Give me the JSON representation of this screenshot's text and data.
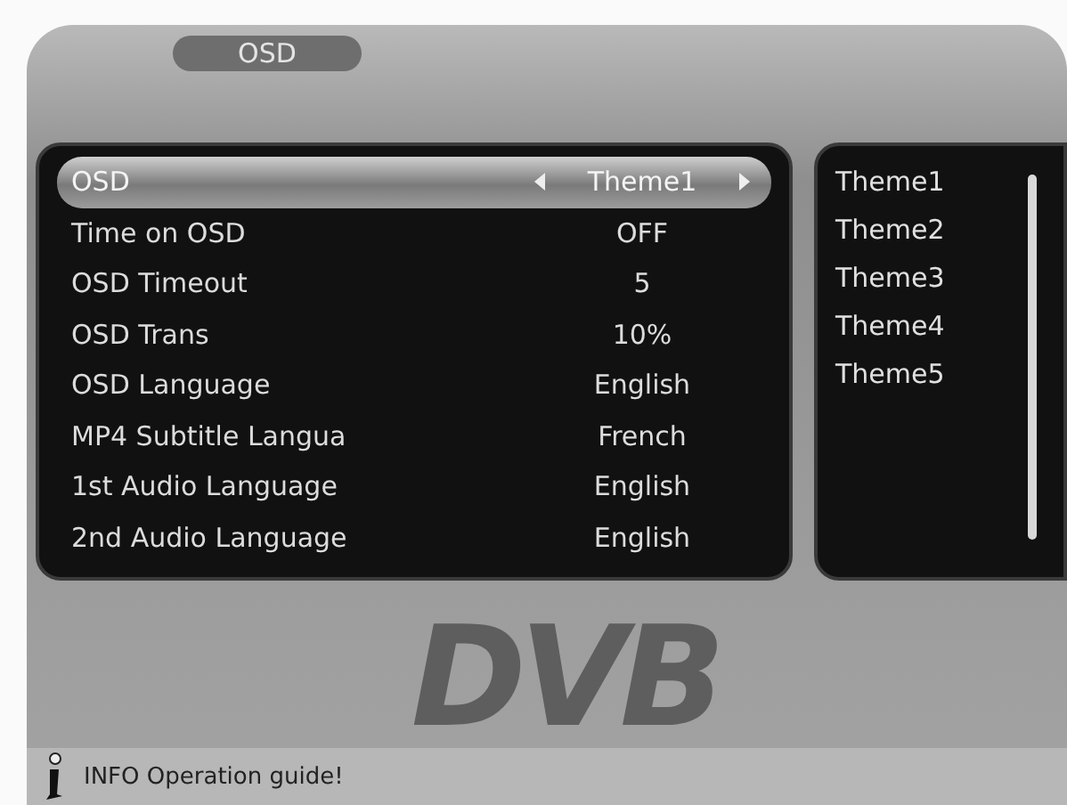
{
  "title": "OSD",
  "settings": [
    {
      "label": "OSD",
      "value": "Theme1",
      "selected": true
    },
    {
      "label": "Time on OSD",
      "value": "OFF",
      "selected": false
    },
    {
      "label": "OSD Timeout",
      "value": "5",
      "selected": false
    },
    {
      "label": "OSD Trans",
      "value": "10%",
      "selected": false
    },
    {
      "label": "OSD Language",
      "value": "English",
      "selected": false
    },
    {
      "label": "MP4 Subtitle Langua",
      "value": "French",
      "selected": false
    },
    {
      "label": "1st Audio Language",
      "value": "English",
      "selected": false
    },
    {
      "label": "2nd Audio Language",
      "value": "English",
      "selected": false
    }
  ],
  "options": [
    "Theme1",
    "Theme2",
    "Theme3",
    "Theme4",
    "Theme5"
  ],
  "background_logo": "DVB",
  "info_bar": "INFO Operation guide!"
}
